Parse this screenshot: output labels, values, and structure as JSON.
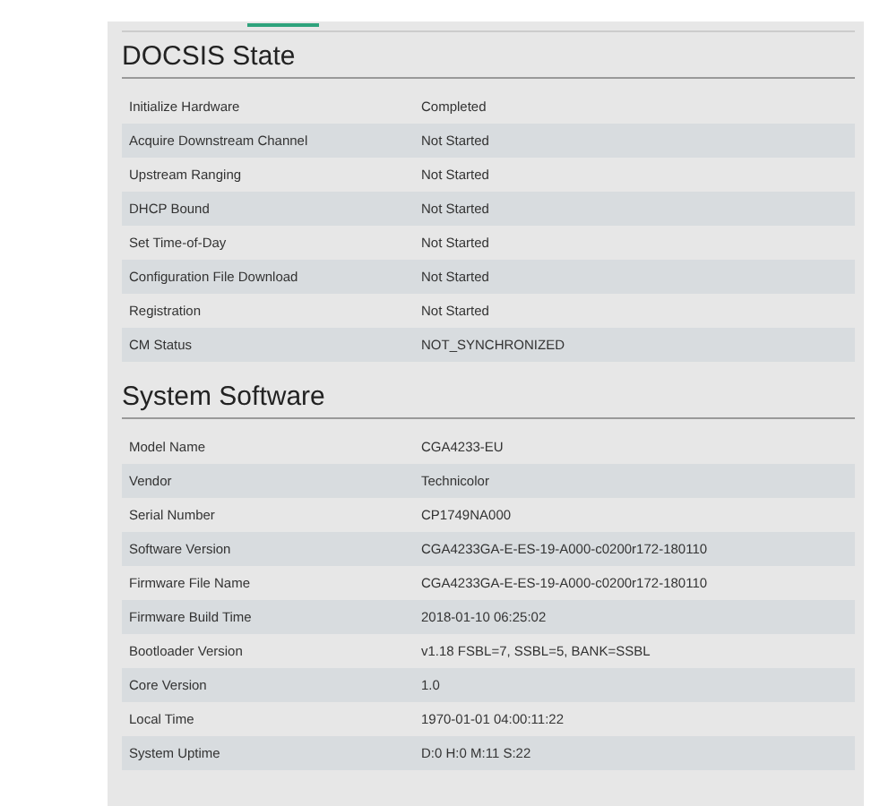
{
  "sections": [
    {
      "title": "DOCSIS State",
      "rows": [
        {
          "label": "Initialize Hardware",
          "value": "Completed"
        },
        {
          "label": "Acquire Downstream Channel",
          "value": "Not Started"
        },
        {
          "label": "Upstream Ranging",
          "value": "Not Started"
        },
        {
          "label": "DHCP Bound",
          "value": "Not Started"
        },
        {
          "label": "Set Time-of-Day",
          "value": "Not Started"
        },
        {
          "label": "Configuration File Download",
          "value": "Not Started"
        },
        {
          "label": "Registration",
          "value": "Not Started"
        },
        {
          "label": "CM Status",
          "value": "NOT_SYNCHRONIZED"
        }
      ]
    },
    {
      "title": "System Software",
      "rows": [
        {
          "label": "Model Name",
          "value": "CGA4233-EU"
        },
        {
          "label": "Vendor",
          "value": "Technicolor"
        },
        {
          "label": "Serial Number",
          "value": "CP1749NA000"
        },
        {
          "label": "Software Version",
          "value": "CGA4233GA-E-ES-19-A000-c0200r172-180110"
        },
        {
          "label": "Firmware File Name",
          "value": "CGA4233GA-E-ES-19-A000-c0200r172-180110"
        },
        {
          "label": "Firmware Build Time",
          "value": "2018-01-10 06:25:02"
        },
        {
          "label": "Bootloader Version",
          "value": "v1.18 FSBL=7, SSBL=5, BANK=SSBL"
        },
        {
          "label": "Core Version",
          "value": "1.0"
        },
        {
          "label": "Local Time",
          "value": "1970-01-01 04:00:11:22"
        },
        {
          "label": "System Uptime",
          "value": "D:0 H:0 M:11 S:22"
        }
      ]
    }
  ]
}
